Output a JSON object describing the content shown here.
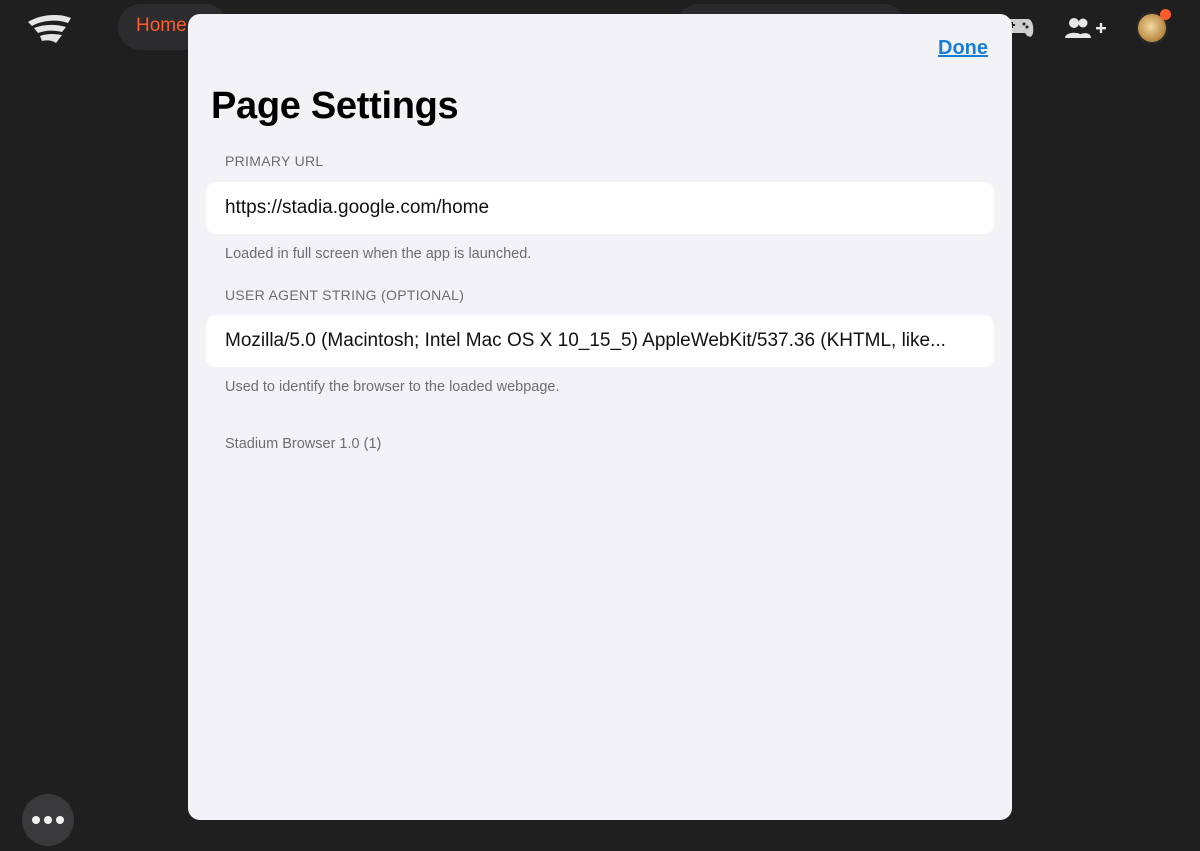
{
  "background_app": {
    "home_tab_label": "Home",
    "accent_color": "#ff5a2c",
    "icons": [
      "stadia-logo-icon",
      "gamepad-icon",
      "add-friend-icon",
      "avatar",
      "more-icon"
    ]
  },
  "modal": {
    "title": "Page Settings",
    "done_label": "Done",
    "primary_url": {
      "label": "PRIMARY URL",
      "value": "https://stadia.google.com/home",
      "footnote": "Loaded in full screen when the app is launched."
    },
    "user_agent": {
      "label": "USER AGENT STRING (OPTIONAL)",
      "value": "Mozilla/5.0 (Macintosh; Intel Mac OS X 10_15_5) AppleWebKit/537.36 (KHTML, like...",
      "footnote": "Used to identify the browser to the loaded webpage."
    },
    "version": "Stadium Browser 1.0 (1)"
  }
}
